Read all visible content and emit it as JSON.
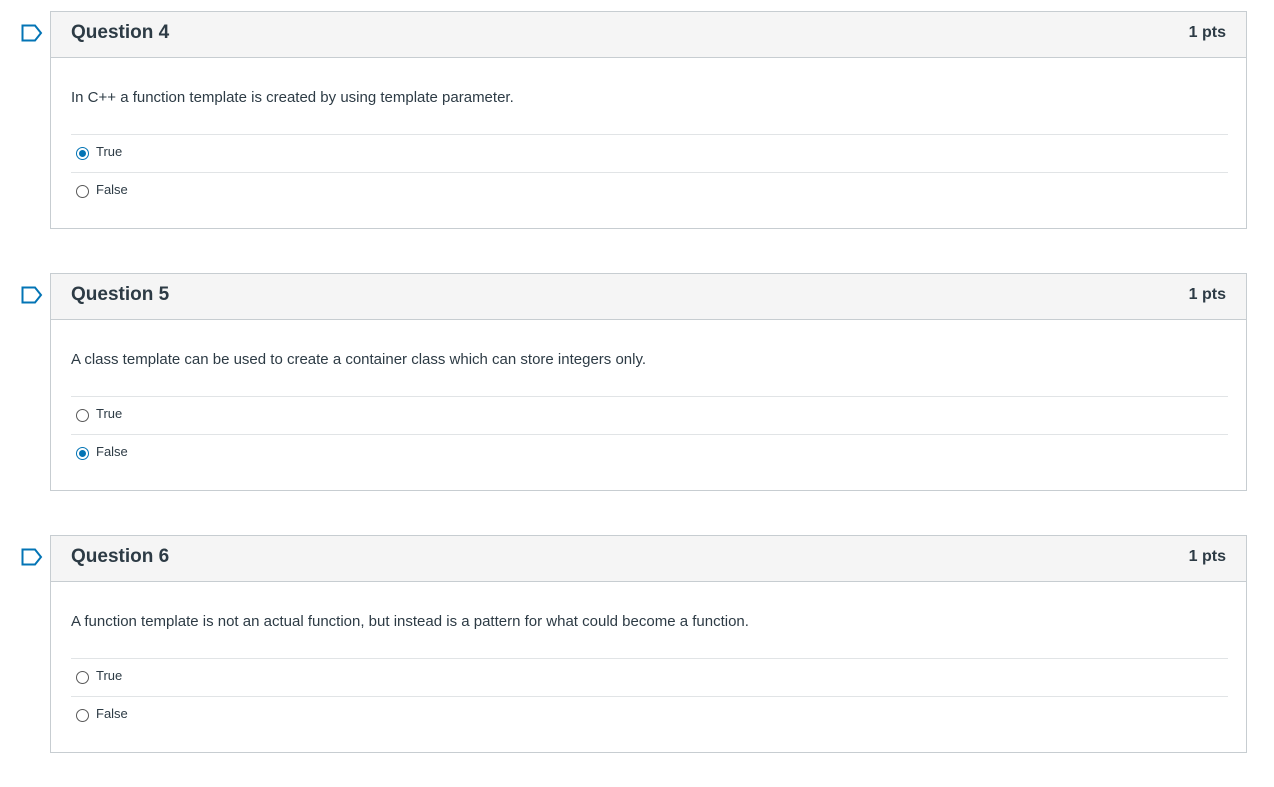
{
  "questions": [
    {
      "title": "Question 4",
      "points": "1 pts",
      "text": "In C++ a function template is created by using template parameter.",
      "answers": [
        {
          "label": "True",
          "selected": true
        },
        {
          "label": "False",
          "selected": false
        }
      ]
    },
    {
      "title": "Question 5",
      "points": "1 pts",
      "text": "A class template can be used to create a container class which can store integers only.",
      "answers": [
        {
          "label": "True",
          "selected": false
        },
        {
          "label": "False",
          "selected": true
        }
      ]
    },
    {
      "title": "Question 6",
      "points": "1 pts",
      "text": "A function template is not an actual function, but instead is a pattern for what could become a function.",
      "answers": [
        {
          "label": "True",
          "selected": false
        },
        {
          "label": "False",
          "selected": false
        }
      ]
    }
  ],
  "colors": {
    "accent": "#0374b5",
    "header_bg": "#f5f5f5",
    "border": "#c7cdd1",
    "text": "#2d3b45"
  }
}
